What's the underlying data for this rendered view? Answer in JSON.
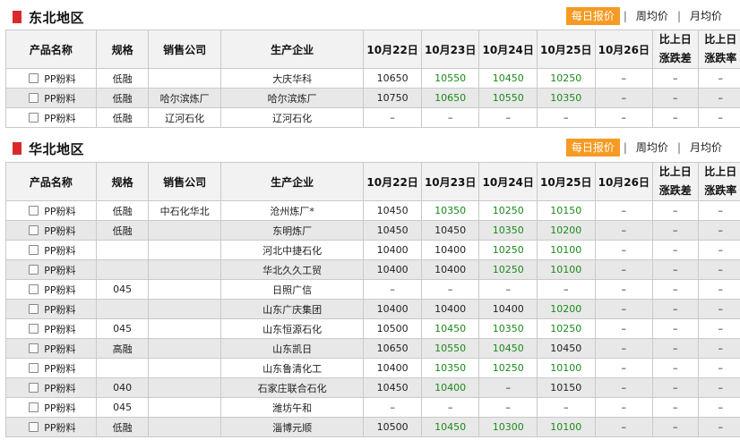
{
  "tabs": {
    "daily": "每日报价",
    "weekly": "周均价",
    "monthly": "月均价",
    "sep": "|"
  },
  "columns": [
    "产品名称",
    "规格",
    "销售公司",
    "生产企业",
    "10月22日",
    "10月23日",
    "10月24日",
    "10月25日",
    "10月26日",
    [
      "比上日",
      "涨跌差"
    ],
    [
      "比上日",
      "涨跌率"
    ]
  ],
  "colors": {
    "up": "#1a8a1a",
    "marker": "#d9292b",
    "active_tab": "#f59a23"
  },
  "sections": [
    {
      "title": "东北地区",
      "rows": [
        {
          "name": "PP粉料",
          "spec": "低融",
          "seller": "",
          "maker": "大庆华科",
          "d22": "10650",
          "d23": "10550",
          "d24": "10450",
          "d25": "10250",
          "d26": "–",
          "diff": "–",
          "rate": "–",
          "green": [
            1,
            2,
            3
          ]
        },
        {
          "name": "PP粉料",
          "spec": "低融",
          "seller": "哈尔滨炼厂",
          "maker": "哈尔滨炼厂",
          "d22": "10750",
          "d23": "10650",
          "d24": "10550",
          "d25": "10350",
          "d26": "–",
          "diff": "–",
          "rate": "–",
          "green": [
            1,
            2,
            3
          ]
        },
        {
          "name": "PP粉料",
          "spec": "低融",
          "seller": "辽河石化",
          "maker": "辽河石化",
          "d22": "–",
          "d23": "–",
          "d24": "–",
          "d25": "–",
          "d26": "–",
          "diff": "–",
          "rate": "–",
          "green": []
        }
      ]
    },
    {
      "title": "华北地区",
      "rows": [
        {
          "name": "PP粉料",
          "spec": "低融",
          "seller": "中石化华北",
          "maker": "沧州炼厂*",
          "d22": "10450",
          "d23": "10350",
          "d24": "10250",
          "d25": "10150",
          "d26": "–",
          "diff": "–",
          "rate": "–",
          "green": [
            1,
            2,
            3
          ]
        },
        {
          "name": "PP粉料",
          "spec": "低融",
          "seller": "",
          "maker": "东明炼厂",
          "d22": "10450",
          "d23": "10450",
          "d24": "10350",
          "d25": "10200",
          "d26": "–",
          "diff": "–",
          "rate": "–",
          "green": [
            2,
            3
          ]
        },
        {
          "name": "PP粉料",
          "spec": "",
          "seller": "",
          "maker": "河北中捷石化",
          "d22": "10400",
          "d23": "10400",
          "d24": "10250",
          "d25": "10100",
          "d26": "–",
          "diff": "–",
          "rate": "–",
          "green": [
            2,
            3
          ]
        },
        {
          "name": "PP粉料",
          "spec": "",
          "seller": "",
          "maker": "华北久久工贸",
          "d22": "10400",
          "d23": "10400",
          "d24": "10250",
          "d25": "10100",
          "d26": "–",
          "diff": "–",
          "rate": "–",
          "green": [
            2,
            3
          ]
        },
        {
          "name": "PP粉料",
          "spec": "045",
          "seller": "",
          "maker": "日照广信",
          "d22": "–",
          "d23": "–",
          "d24": "–",
          "d25": "–",
          "d26": "–",
          "diff": "–",
          "rate": "–",
          "green": []
        },
        {
          "name": "PP粉料",
          "spec": "",
          "seller": "",
          "maker": "山东广庆集团",
          "d22": "10400",
          "d23": "10400",
          "d24": "10400",
          "d25": "10200",
          "d26": "–",
          "diff": "–",
          "rate": "–",
          "green": [
            3
          ]
        },
        {
          "name": "PP粉料",
          "spec": "045",
          "seller": "",
          "maker": "山东恒源石化",
          "d22": "10500",
          "d23": "10450",
          "d24": "10350",
          "d25": "10250",
          "d26": "–",
          "diff": "–",
          "rate": "–",
          "green": [
            1,
            2,
            3
          ]
        },
        {
          "name": "PP粉料",
          "spec": "高融",
          "seller": "",
          "maker": "山东凯日",
          "d22": "10650",
          "d23": "10550",
          "d24": "10450",
          "d25": "10450",
          "d26": "–",
          "diff": "–",
          "rate": "–",
          "green": [
            1,
            2
          ]
        },
        {
          "name": "PP粉料",
          "spec": "",
          "seller": "",
          "maker": "山东鲁清化工",
          "d22": "10400",
          "d23": "10350",
          "d24": "10250",
          "d25": "10100",
          "d26": "–",
          "diff": "–",
          "rate": "–",
          "green": [
            1,
            2,
            3
          ]
        },
        {
          "name": "PP粉料",
          "spec": "040",
          "seller": "",
          "maker": "石家庄联合石化",
          "d22": "10450",
          "d23": "10400",
          "d24": "–",
          "d25": "10150",
          "d26": "–",
          "diff": "–",
          "rate": "–",
          "green": [
            1
          ]
        },
        {
          "name": "PP粉料",
          "spec": "045",
          "seller": "",
          "maker": "潍坊午和",
          "d22": "–",
          "d23": "–",
          "d24": "–",
          "d25": "–",
          "d26": "–",
          "diff": "–",
          "rate": "–",
          "green": []
        },
        {
          "name": "PP粉料",
          "spec": "低融",
          "seller": "",
          "maker": "淄博元顺",
          "d22": "10500",
          "d23": "10450",
          "d24": "10300",
          "d25": "10100",
          "d26": "–",
          "diff": "–",
          "rate": "–",
          "green": [
            1,
            2,
            3
          ]
        }
      ]
    }
  ]
}
